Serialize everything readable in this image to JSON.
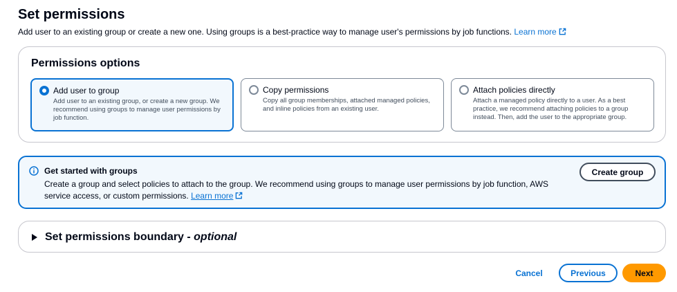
{
  "header": {
    "title": "Set permissions",
    "description": "Add user to an existing group or create a new one. Using groups is a best-practice way to manage user's permissions by job functions.",
    "learn_more": "Learn more"
  },
  "permissions_options": {
    "title": "Permissions options",
    "options": [
      {
        "label": "Add user to group",
        "description": "Add user to an existing group, or create a new group. We recommend using groups to manage user permissions by job function.",
        "selected": true
      },
      {
        "label": "Copy permissions",
        "description": "Copy all group memberships, attached managed policies, and inline policies from an existing user.",
        "selected": false
      },
      {
        "label": "Attach policies directly",
        "description": "Attach a managed policy directly to a user. As a best practice, we recommend attaching policies to a group instead. Then, add the user to the appropriate group.",
        "selected": false
      }
    ]
  },
  "info_alert": {
    "title": "Get started with groups",
    "body": "Create a group and select policies to attach to the group. We recommend using groups to manage user permissions by job function, AWS service access, or custom permissions.",
    "learn_more": "Learn more",
    "button_label": "Create group"
  },
  "boundary": {
    "title": "Set permissions boundary - ",
    "optional": "optional"
  },
  "footer": {
    "cancel": "Cancel",
    "previous": "Previous",
    "next": "Next"
  },
  "colors": {
    "link": "#0972d3",
    "primary_button": "#ff9900",
    "selected_bg": "#f2f8fd"
  }
}
